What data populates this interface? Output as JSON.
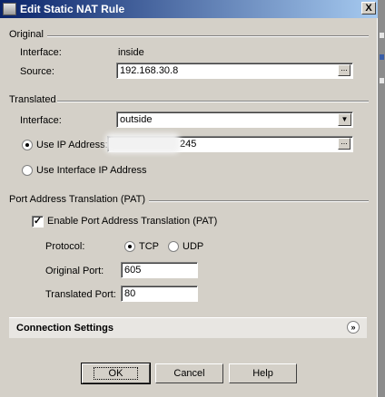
{
  "window": {
    "title": "Edit Static NAT Rule",
    "close_label": "X"
  },
  "original": {
    "group": "Original",
    "interface_label": "Interface:",
    "interface_value": "inside",
    "source_label": "Source:",
    "source_value": "192.168.30.8"
  },
  "translated": {
    "group": "Translated",
    "interface_label": "Interface:",
    "interface_value": "outside",
    "use_ip_label": "Use IP Address:",
    "use_ip_value": "245",
    "use_interface_ip_label": "Use Interface IP Address"
  },
  "pat": {
    "group": "Port Address Translation (PAT)",
    "enable_label": "Enable Port Address Translation (PAT)",
    "enabled": true,
    "protocol_label": "Protocol:",
    "tcp_label": "TCP",
    "udp_label": "UDP",
    "selected_protocol": "TCP",
    "original_port_label": "Original Port:",
    "original_port_value": "605",
    "translated_port_label": "Translated Port:",
    "translated_port_value": "80"
  },
  "connection_settings": {
    "label": "Connection Settings"
  },
  "buttons": {
    "ok": "OK",
    "cancel": "Cancel",
    "help": "Help"
  },
  "icons": {
    "browse": "ellipsis-icon",
    "dropdown": "chevron-down-icon",
    "expand": "double-chevron-down-icon"
  }
}
